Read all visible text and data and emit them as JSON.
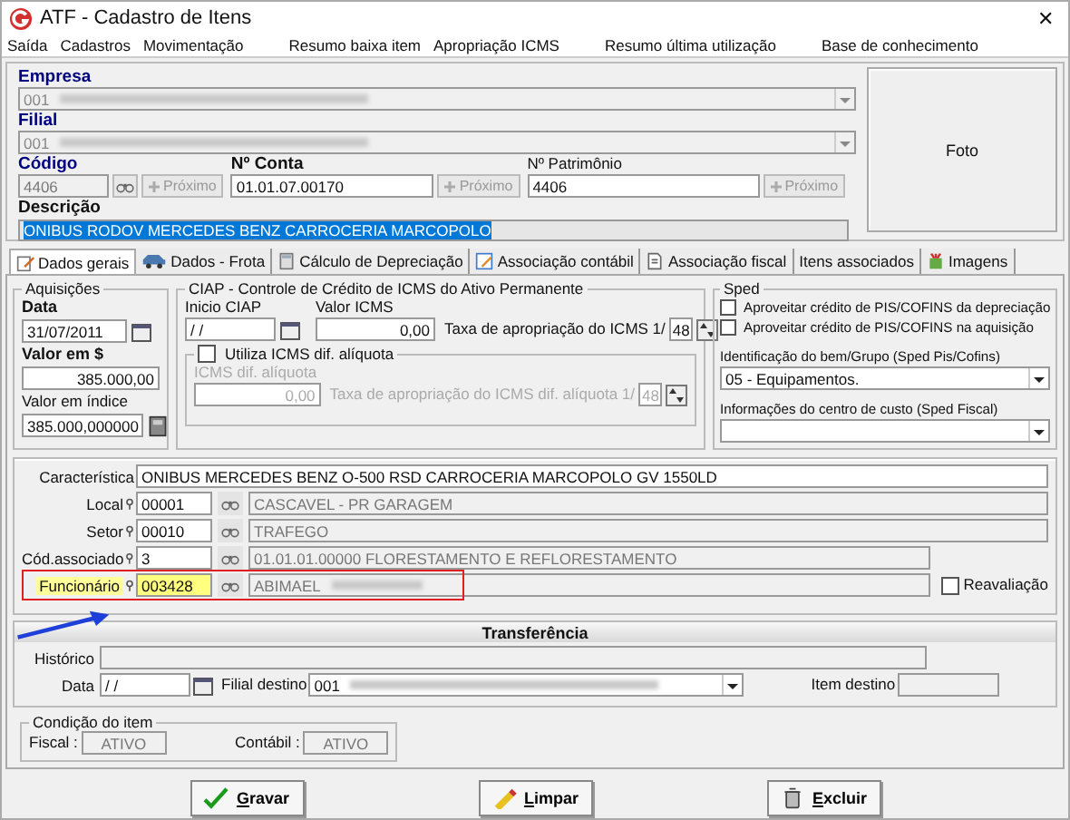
{
  "window": {
    "title": "ATF - Cadastro de Itens",
    "close": "✕"
  },
  "menu": [
    "Saída",
    "Cadastros",
    "Movimentação",
    "Resumo baixa item",
    "Apropriação ICMS",
    "Resumo última utilização",
    "Base de conhecimento"
  ],
  "header": {
    "empresa": {
      "label": "Empresa",
      "value": "001"
    },
    "filial": {
      "label": "Filial",
      "value": "001"
    },
    "codigo": {
      "label": "Código",
      "value": "4406",
      "next": "Próximo"
    },
    "conta": {
      "label": "Nº Conta",
      "value": "01.01.07.00170",
      "next": "Próximo"
    },
    "patrimonio": {
      "label": "Nº Patrimônio",
      "value": "4406",
      "next": "Próximo"
    },
    "descricao": {
      "label": "Descrição",
      "value": "ONIBUS RODOV MERCEDES BENZ CARROCERIA MARCOPOLO",
      "selected": true
    },
    "photo": "Foto"
  },
  "tabs": [
    {
      "label": "Dados gerais",
      "selected": true,
      "kind": "pencil"
    },
    {
      "label": "Dados - Frota",
      "selected": false,
      "kind": "car"
    },
    {
      "label": "Cálculo de Depreciação",
      "selected": false,
      "kind": "calculator"
    },
    {
      "label": "Associação contábil",
      "selected": false,
      "kind": "edit"
    },
    {
      "label": "Associação fiscal",
      "selected": false,
      "kind": "document"
    },
    {
      "label": "Itens associados",
      "selected": false,
      "kind": "none"
    },
    {
      "label": "Imagens",
      "selected": false,
      "kind": "paint"
    }
  ],
  "aquisicoes": {
    "title": "Aquisições",
    "data_label": "Data",
    "data": "31/07/2011",
    "valor_label": "Valor em $",
    "valor": "385.000,00",
    "indice_label": "Valor em índice",
    "indice": "385.000,000000"
  },
  "ciap": {
    "title": "CIAP - Controle de Crédito de ICMS do Ativo Permanente",
    "inicio_label": "Inicio CIAP",
    "inicio": "/ /",
    "valor_label": "Valor ICMS",
    "valor": "0,00",
    "taxa_label": "Taxa de apropriação do ICMS 1/",
    "taxa": "48",
    "dif": {
      "label": "Utiliza ICMS dif. alíquota",
      "checked": false,
      "value_label": "ICMS dif. alíquota",
      "value": "0,00",
      "taxa_label": "Taxa de apropriação do ICMS dif. alíquota 1/",
      "taxa": "48",
      "disabled": true
    }
  },
  "sped": {
    "title": "Sped",
    "checks": [
      {
        "label": "Aproveitar crédito de PIS/COFINS da depreciação",
        "checked": false
      },
      {
        "label": "Aproveitar crédito de PIS/COFINS na aquisição",
        "checked": false
      }
    ],
    "ident_label": "Identificação do bem/Grupo (Sped Pis/Cofins)",
    "ident": "05 - Equipamentos.",
    "info_label": "Informações do centro de custo (Sped Fiscal)"
  },
  "details": {
    "caracteristica_label": "Característica",
    "caracteristica": "ONIBUS MERCEDES BENZ O-500 RSD CARROCERIA MARCOPOLO GV 1550LD",
    "rows": [
      {
        "label": "Local",
        "code": "00001",
        "description": "CASCAVEL - PR GARAGEM",
        "highlighted": false
      },
      {
        "label": "Setor",
        "code": "00010",
        "description": "TRAFEGO",
        "highlighted": false
      },
      {
        "label": "Cód.associado",
        "code": "3",
        "description": "01.01.01.00000 FLORESTAMENTO E REFLORESTAMENTO",
        "highlighted": false
      },
      {
        "label": "Funcionário",
        "code": "003428",
        "description": "ABIMAEL",
        "highlighted": true
      }
    ],
    "reavaliacao": {
      "label": "Reavaliação",
      "checked": false
    }
  },
  "transferencia": {
    "title": "Transferência",
    "historico_label": "Histórico",
    "data_label": "Data",
    "data": "/ /",
    "filial_label": "Filial destino",
    "filial": "001",
    "item_label": "Item destino"
  },
  "condicao": {
    "title": "Condição do item",
    "fiscal_label": "Fiscal :",
    "fiscal": "ATIVO",
    "contabil_label": "Contábil :",
    "contabil": "ATIVO"
  },
  "buttons": [
    {
      "label": "Gravar",
      "kind": "save"
    },
    {
      "label": "Limpar",
      "kind": "clear"
    },
    {
      "label": "Excluir",
      "kind": "delete"
    }
  ]
}
